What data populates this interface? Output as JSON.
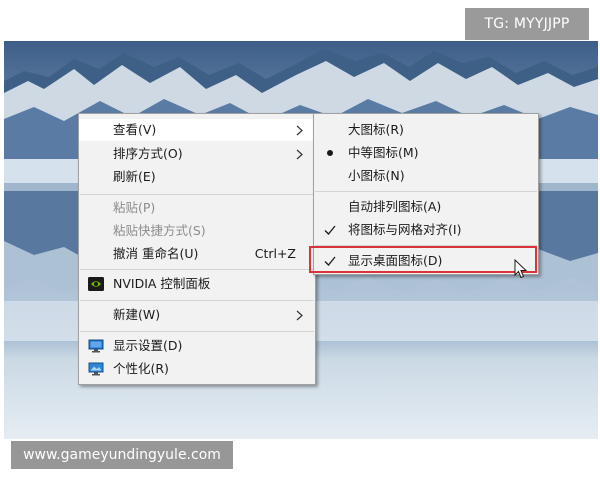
{
  "watermark": {
    "tg_label": "TG: MYYJJPP",
    "site_url": "www.gameyundingyule.com"
  },
  "context_menu": {
    "items": [
      {
        "label": "查看(V)",
        "submenu": true,
        "highlighted": true,
        "enabled": true
      },
      {
        "label": "排序方式(O)",
        "submenu": true,
        "enabled": true
      },
      {
        "label": "刷新(E)",
        "enabled": true
      },
      {
        "label": "粘贴(P)",
        "enabled": false
      },
      {
        "label": "粘贴快捷方式(S)",
        "enabled": false
      },
      {
        "label": "撤消 重命名(U)",
        "shortcut": "Ctrl+Z",
        "enabled": true
      },
      {
        "label": "NVIDIA 控制面板",
        "icon": "nvidia-icon",
        "enabled": true
      },
      {
        "label": "新建(W)",
        "submenu": true,
        "enabled": true
      },
      {
        "label": "显示设置(D)",
        "icon": "display-settings-icon",
        "enabled": true
      },
      {
        "label": "个性化(R)",
        "icon": "personalize-icon",
        "enabled": true
      }
    ]
  },
  "view_submenu": {
    "items": [
      {
        "label": "大图标(R)",
        "mark": "none"
      },
      {
        "label": "中等图标(M)",
        "mark": "bullet"
      },
      {
        "label": "小图标(N)",
        "mark": "none"
      },
      {
        "label": "自动排列图标(A)",
        "mark": "none"
      },
      {
        "label": "将图标与网格对齐(I)",
        "mark": "check"
      },
      {
        "label": "显示桌面图标(D)",
        "mark": "check",
        "highlighted_by_red_box": true
      }
    ]
  },
  "colors": {
    "menu_bg": "#f2f2f2",
    "menu_hover": "#ffffff",
    "highlight_box": "#d9343a",
    "disabled_text": "#8c8c8c",
    "nvidia_green": "#76b900"
  }
}
